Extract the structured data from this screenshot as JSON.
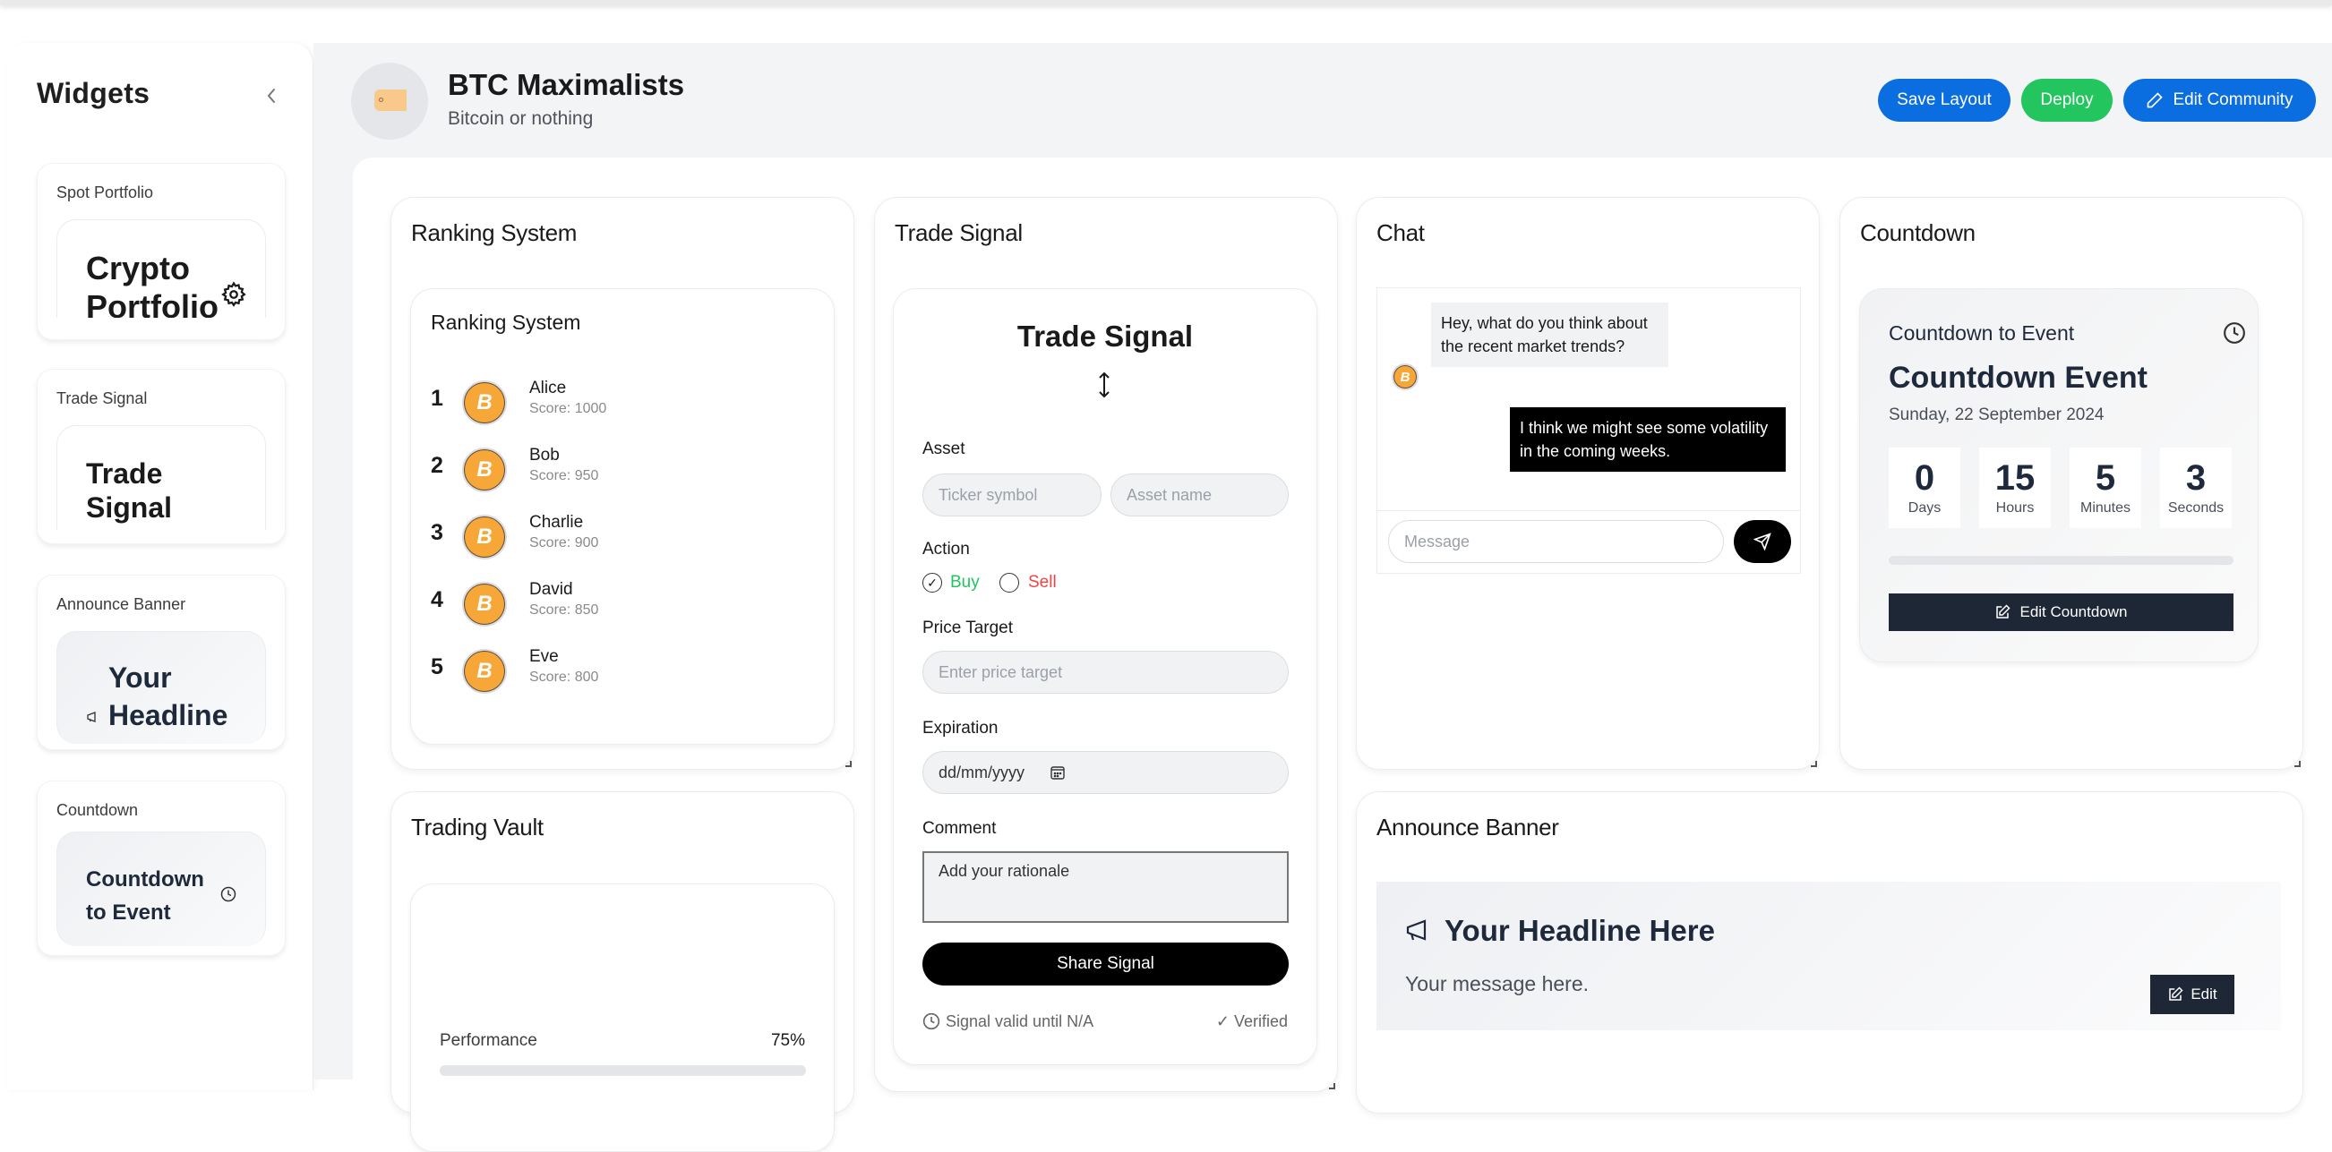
{
  "sidebar": {
    "title": "Widgets",
    "collapse_icon": "chevron-left-icon",
    "items": [
      {
        "label": "Spot Portfolio",
        "preview_text": "Crypto Portfolio",
        "preview_icon": "gear-icon"
      },
      {
        "label": "Trade Signal",
        "preview_text": "Trade Signal"
      },
      {
        "label": "Announce Banner",
        "preview_text": "Your Headline",
        "preview_icon": "megaphone-icon"
      },
      {
        "label": "Countdown",
        "preview_text": "Countdown to Event",
        "preview_icon": "clock-icon"
      }
    ]
  },
  "header": {
    "community_name": "BTC Maximalists",
    "community_tagline": "Bitcoin or nothing",
    "logo_icon": "tag-icon",
    "buttons": {
      "save_layout": "Save Layout",
      "deploy": "Deploy",
      "edit_community": "Edit Community"
    },
    "colors": {
      "primary": "#0a6ee0",
      "deploy": "#22c55e"
    }
  },
  "widgets": {
    "ranking": {
      "title": "Ranking System",
      "inner_title": "Ranking System",
      "entries": [
        {
          "rank": "1",
          "name": "Alice",
          "score": "Score: 1000"
        },
        {
          "rank": "2",
          "name": "Bob",
          "score": "Score: 950"
        },
        {
          "rank": "3",
          "name": "Charlie",
          "score": "Score: 900"
        },
        {
          "rank": "4",
          "name": "David",
          "score": "Score: 850"
        },
        {
          "rank": "5",
          "name": "Eve",
          "score": "Score: 800"
        }
      ]
    },
    "trade_signal": {
      "title": "Trade Signal",
      "inner_title": "Trade Signal",
      "asset_label": "Asset",
      "ticker_placeholder": "Ticker symbol",
      "asset_name_placeholder": "Asset name",
      "action_label": "Action",
      "buy_label": "Buy",
      "sell_label": "Sell",
      "selected_action": "Buy",
      "price_target_label": "Price Target",
      "price_target_placeholder": "Enter price target",
      "expiration_label": "Expiration",
      "expiration_placeholder": "dd/mm/yyyy",
      "comment_label": "Comment",
      "comment_placeholder": "Add your rationale",
      "share_button": "Share Signal",
      "valid_until": "Signal valid until N/A",
      "verified": "Verified",
      "colors": {
        "buy": "#22c55e",
        "sell": "#ef4444"
      }
    },
    "chat": {
      "title": "Chat",
      "messages": [
        {
          "direction": "incoming",
          "text": "Hey, what do you think about the recent market trends?"
        },
        {
          "direction": "outgoing",
          "text": "I think we might see some volatility in the coming weeks."
        }
      ],
      "input_placeholder": "Message",
      "send_icon": "send-icon"
    },
    "countdown": {
      "title": "Countdown",
      "card_title": "Countdown to Event",
      "event_name": "Countdown Event",
      "event_date": "Sunday, 22 September 2024",
      "units": [
        {
          "value": "0",
          "label": "Days"
        },
        {
          "value": "15",
          "label": "Hours"
        },
        {
          "value": "5",
          "label": "Minutes"
        },
        {
          "value": "3",
          "label": "Seconds"
        }
      ],
      "edit_button": "Edit Countdown"
    },
    "trading_vault": {
      "title": "Trading Vault",
      "performance_label": "Performance",
      "performance_value": "75%",
      "performance_fraction": 0.75
    },
    "announce_banner": {
      "title": "Announce Banner",
      "headline": "Your Headline Here",
      "message": "Your message here.",
      "edit_button": "Edit"
    }
  }
}
